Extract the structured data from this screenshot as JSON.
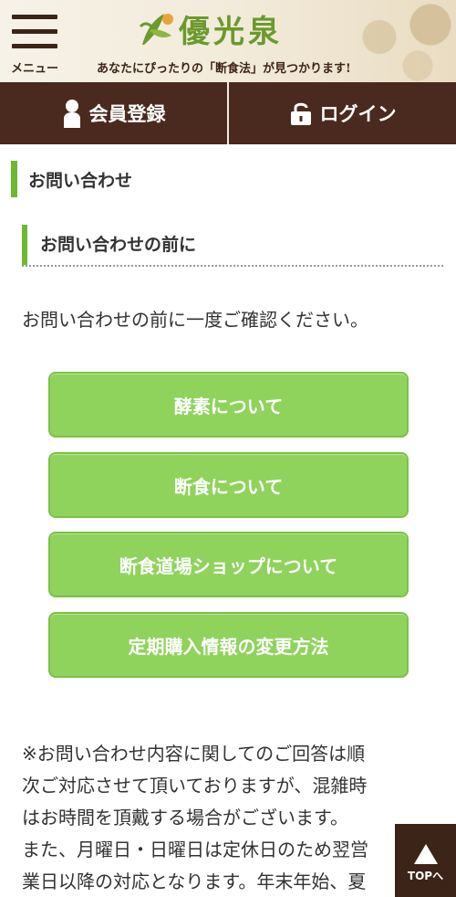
{
  "header": {
    "menu_label": "メニュー",
    "logo_text": "優光泉",
    "tagline": "あなたにぴったりの「断食法」が見つかります!"
  },
  "nav": {
    "register_label": "会員登録",
    "login_label": "ログイン"
  },
  "page": {
    "title": "お問い合わせ",
    "section_title": "お問い合わせの前に",
    "intro": "お問い合わせの前に一度ご確認ください。"
  },
  "buttons": [
    {
      "label": "酵素について"
    },
    {
      "label": "断食について"
    },
    {
      "label": "断食道場ショップについて"
    },
    {
      "label": "定期購入情報の変更方法"
    }
  ],
  "note": {
    "lines": [
      "※お問い合わせ内容に関してのご回答は順",
      "次ご対応させて頂いておりますが、混雑時",
      "はお時間を頂戴する場合がございます。",
      "また、月曜日・日曜日は定休日のため翌営",
      "業日以降の対応となります。年末年始、夏"
    ]
  },
  "top_button": {
    "label": "TOPへ"
  },
  "colors": {
    "brand_brown": "#4a2a1e",
    "accent_green": "#6bb92f",
    "button_green": "#8fd35c"
  }
}
